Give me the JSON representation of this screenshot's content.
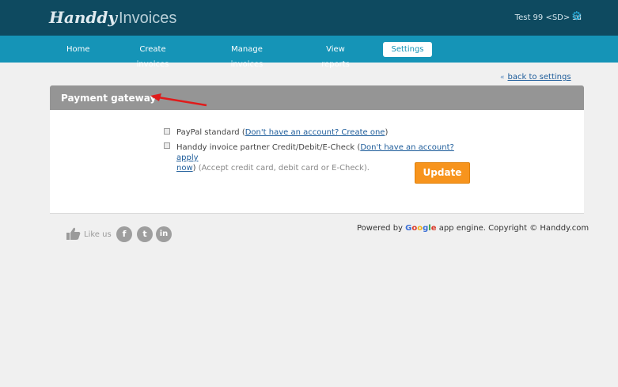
{
  "header": {
    "logo_script": "Handdy",
    "logo_rest": "Invoices",
    "user": "Test 99 <SD> sd",
    "gear_icon": "gear-icon"
  },
  "nav": {
    "items": [
      {
        "label": "Home"
      },
      {
        "label": "Create invoices"
      },
      {
        "label": "Manage invoices"
      },
      {
        "label": "View reports"
      },
      {
        "label": "Settings",
        "active": true
      }
    ]
  },
  "back_link": "back to settings",
  "panel": {
    "title": "Payment gateway",
    "options": [
      {
        "text": "PayPal standard (",
        "link": "Don't have an account? Create one",
        "after": ")"
      },
      {
        "text": "Handdy invoice partner Credit/Debit/E-Check (",
        "link1": "Don't have an account? apply",
        "link2": "now",
        "after": ")",
        "muted": " (Accept credit card, debit card or E-Check)."
      }
    ],
    "update_label": "Update"
  },
  "footer": {
    "like_text": "Like us",
    "social": [
      "f",
      "t",
      "in"
    ],
    "powered_prefix": "Powered by ",
    "google": [
      "G",
      "o",
      "o",
      "g",
      "l",
      "e"
    ],
    "powered_suffix": " app engine. Copyright © Handdy.com"
  },
  "colors": {
    "topbar": "#0e4a60",
    "navbar": "#1594b7",
    "panel_head": "#959595",
    "button": "#f7941d"
  }
}
